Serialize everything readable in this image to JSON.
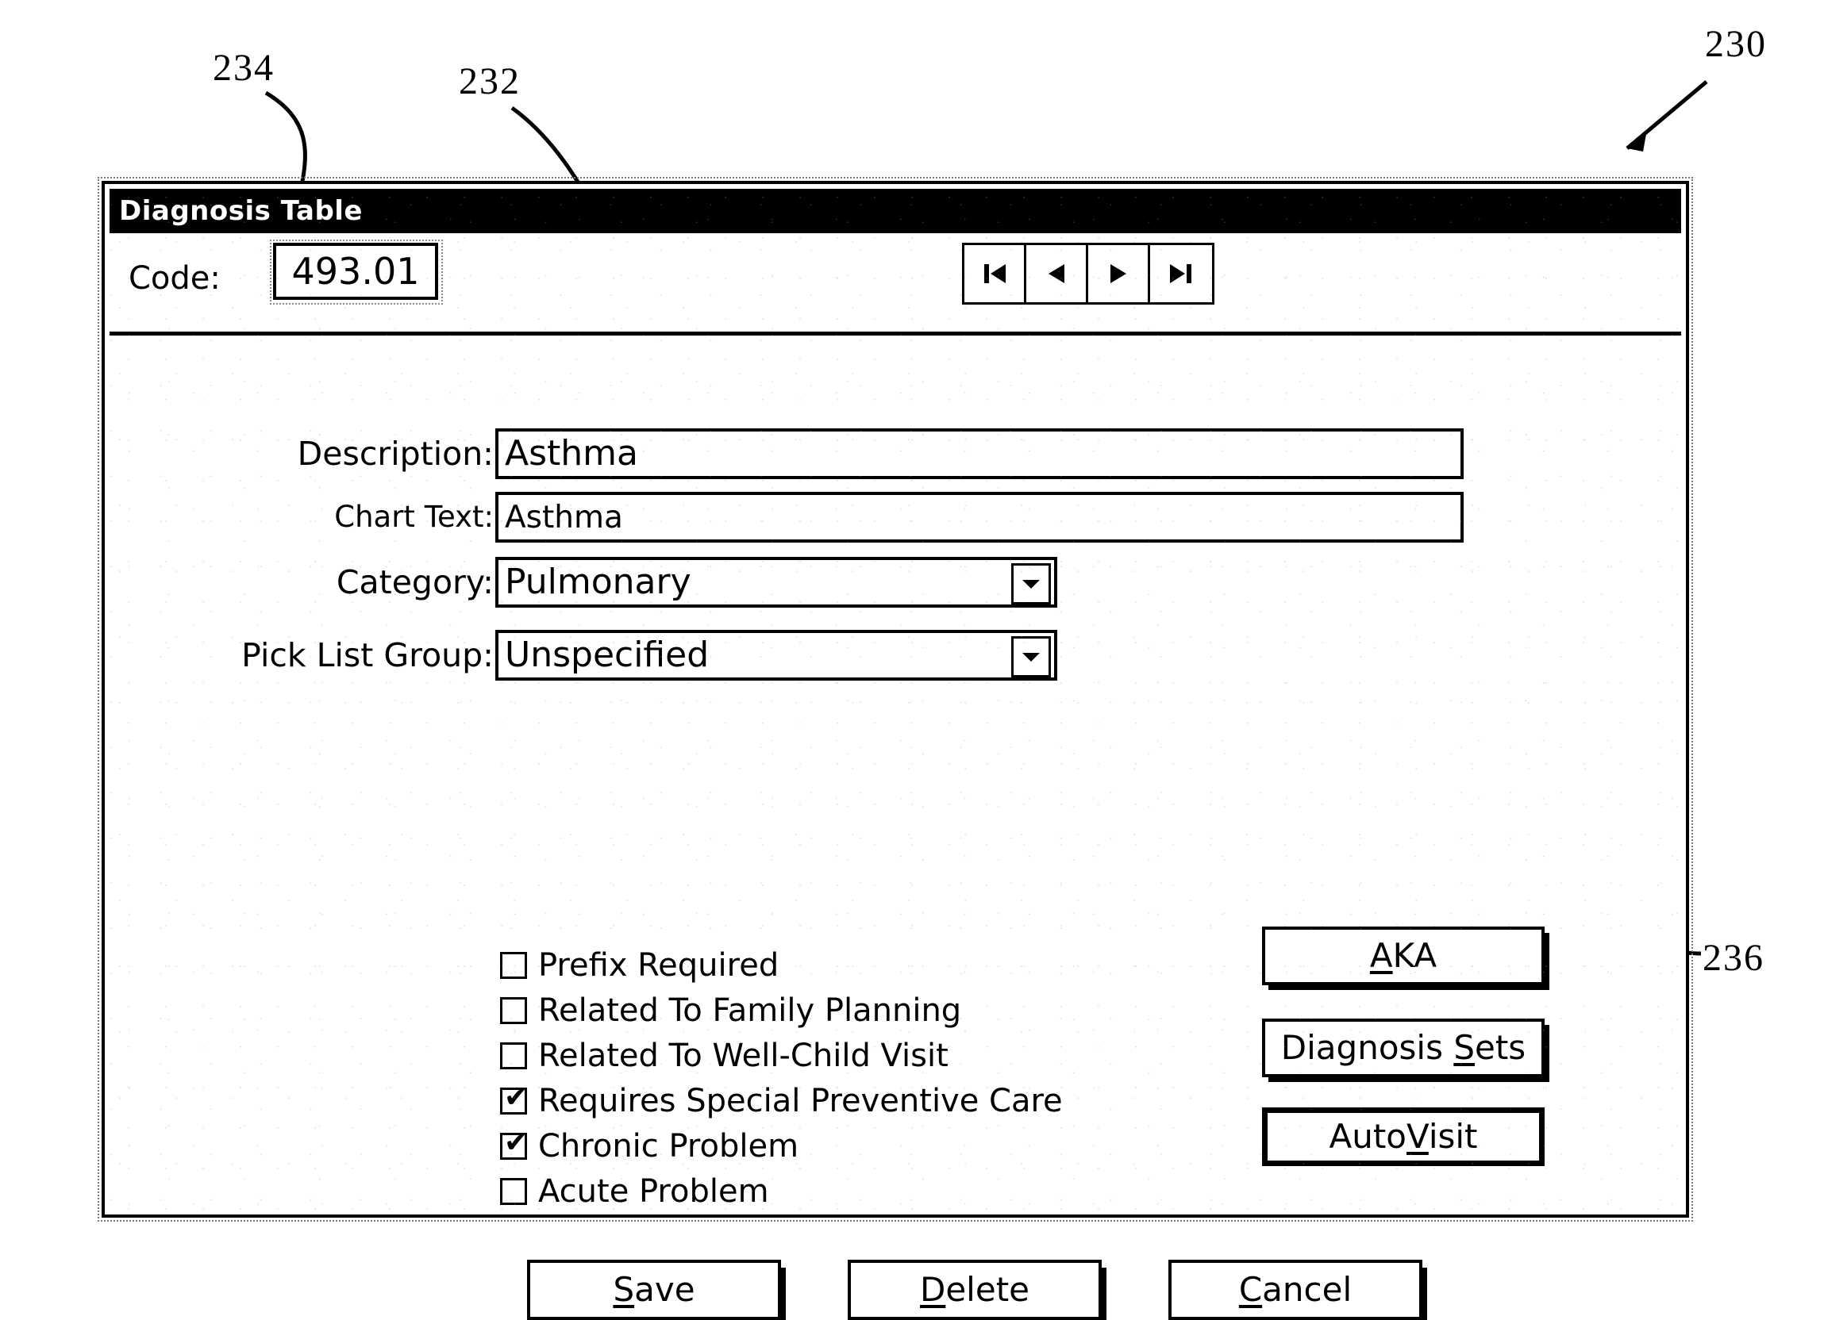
{
  "figure": {
    "reference_numerals": [
      {
        "id": "230",
        "label": "230"
      },
      {
        "id": "232",
        "label": "232"
      },
      {
        "id": "234",
        "label": "234"
      },
      {
        "id": "236",
        "label": "236"
      }
    ]
  },
  "dialog": {
    "title": "Diagnosis Table",
    "code": {
      "label": "Code:",
      "value": "493.01"
    },
    "navigation": [
      {
        "name": "first-record",
        "glyph": "first"
      },
      {
        "name": "previous-record",
        "glyph": "prev"
      },
      {
        "name": "next-record",
        "glyph": "next"
      },
      {
        "name": "last-record",
        "glyph": "last"
      }
    ],
    "fields": [
      {
        "label": "Description:",
        "value": "Asthma",
        "type": "text"
      },
      {
        "label": "Chart Text:",
        "value": "Asthma",
        "type": "text"
      },
      {
        "label": "Category:",
        "value": "Pulmonary",
        "type": "combobox"
      },
      {
        "label": "Pick List Group:",
        "value": "Unspecified",
        "type": "combobox"
      }
    ],
    "checkboxes": [
      {
        "label": "Prefix Required",
        "checked": false
      },
      {
        "label": "Related To Family Planning",
        "checked": false
      },
      {
        "label": "Related To Well-Child Visit",
        "checked": false
      },
      {
        "label": "Requires Special Preventive Care",
        "checked": true
      },
      {
        "label": "Chronic Problem",
        "checked": true
      },
      {
        "label": "Acute Problem",
        "checked": false
      }
    ],
    "side_buttons": [
      {
        "label": "AKA",
        "mnemonic": "A",
        "default": false
      },
      {
        "label": "Diagnosis Sets",
        "mnemonic": "S",
        "default": false
      },
      {
        "label": "AutoVisit",
        "mnemonic": "V",
        "default": true
      }
    ],
    "bottom_buttons": [
      {
        "label": "Save",
        "mnemonic": "S"
      },
      {
        "label": "Delete",
        "mnemonic": "D"
      },
      {
        "label": "Cancel",
        "mnemonic": "C"
      }
    ],
    "checked_mark": "✔"
  }
}
